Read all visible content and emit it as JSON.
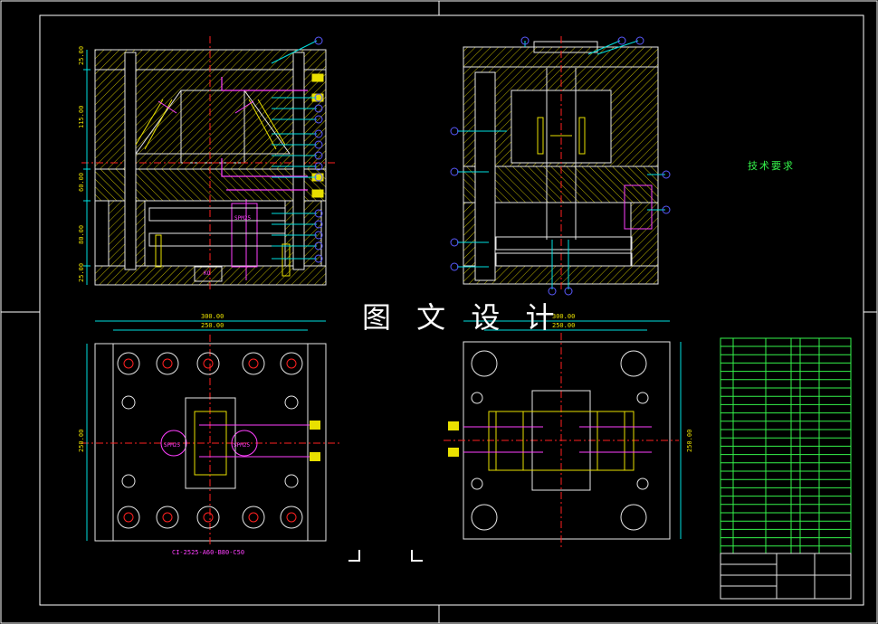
{
  "watermark": "图 文 设 计",
  "tech_requirements": {
    "title": "技术要求",
    "notes": []
  },
  "mold_code": "CI-2525-A60-B80-C50",
  "part_labels": {
    "spacer_left": "SPM25",
    "spacer_right": "SPM25",
    "insert": "KO",
    "front_left": "SPM25",
    "front_right": "SPM25"
  },
  "dimensions": {
    "section_left": [
      "25.00",
      "115.00",
      "60.00",
      "80.00",
      "25.00"
    ],
    "top_view_left": {
      "outer": "300.00",
      "inner": "250.00",
      "height": "250.00"
    },
    "top_view_right": {
      "outer": "300.00",
      "inner": "250.00",
      "height": "250.00"
    }
  },
  "colors": {
    "border": "#ffffff",
    "outline": "#e6e6e6",
    "hatch": "#e9e000",
    "leader": "#00e0e0",
    "balloon": "#5a5aff",
    "centerline": "#ff2020",
    "spacer": "#ff3fff",
    "cooling": "#ff7f00",
    "table": "#34f24a"
  },
  "icons": [
    "corner-mark-icon"
  ]
}
